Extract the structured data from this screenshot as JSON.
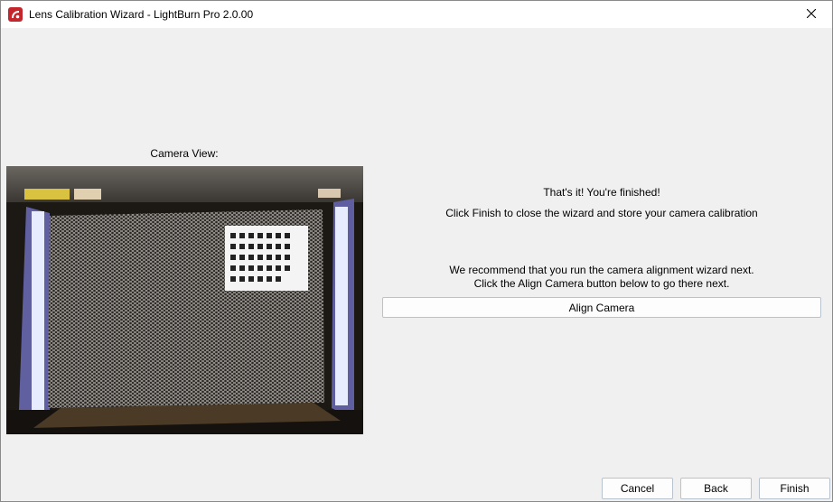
{
  "window": {
    "title": "Lens Calibration Wizard - LightBurn Pro 2.0.00"
  },
  "camera": {
    "label": "Camera View:"
  },
  "messages": {
    "finished": "That's it!  You're finished!",
    "instructions": "Click Finish to close the wizard and store your camera calibration",
    "recommend": "We recommend that you run the camera alignment wizard next.",
    "align_hint": "Click the Align Camera button below to go there next."
  },
  "buttons": {
    "align_camera": "Align Camera",
    "cancel": "Cancel",
    "back": "Back",
    "finish": "Finish"
  },
  "icons": {
    "app": "lightburn-logo-icon",
    "close": "close-icon"
  },
  "colors": {
    "app_icon": "#c4262e",
    "window_bg": "#f0f0f0",
    "button_border": "#b9c3cf"
  }
}
